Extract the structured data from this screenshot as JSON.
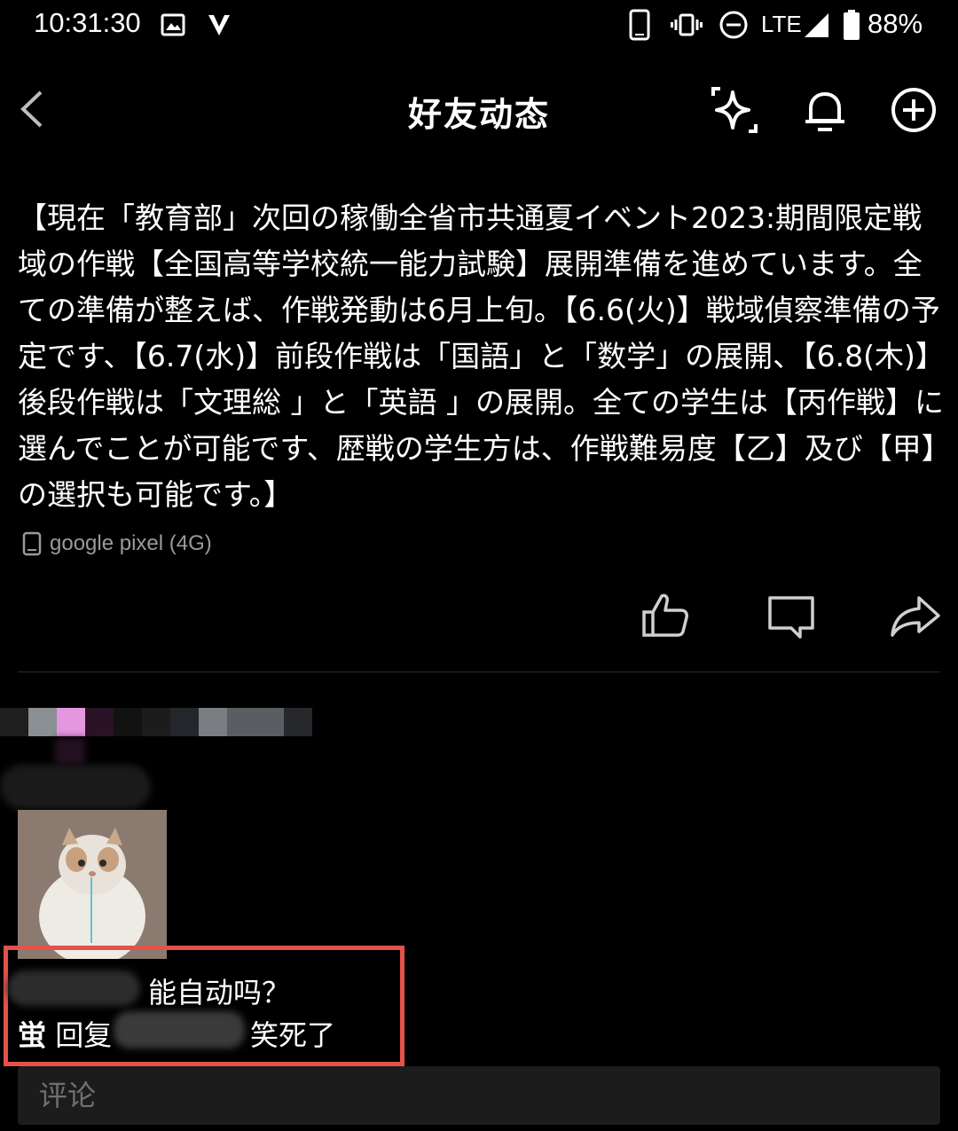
{
  "status_bar": {
    "time": "10:31:30",
    "network": "LTE",
    "battery": "88%"
  },
  "header": {
    "title": "好友动态"
  },
  "post": {
    "text": "【現在「教育部」次回の稼働全省市共通夏イベント2023:期間限定戦域の作戦【全国高等学校統一能力試験】展開準備を進めています。全ての準備が整えば、作戦発動は6月上旬。【6.6(火)】戦域偵察準備の予定です、【6.7(水)】前段作戦は「国語」と「数学」の展開、【6.8(木)】後段作戦は「文理総 」と「英語 」の展開。全ての学生は【丙作戦】に選んでことが可能です、歴戦の学生方は、作戦難易度【乙】及び【甲】の選択も可能です。】",
    "device": "google pixel (4G)"
  },
  "comments": {
    "question": "能自动吗？",
    "reply_user": "蛍",
    "reply_word": "回复",
    "reply_text": "笑死了"
  },
  "input": {
    "placeholder": "评论"
  },
  "colors": {
    "highlight_border": "#e4524a",
    "background": "#000000"
  }
}
